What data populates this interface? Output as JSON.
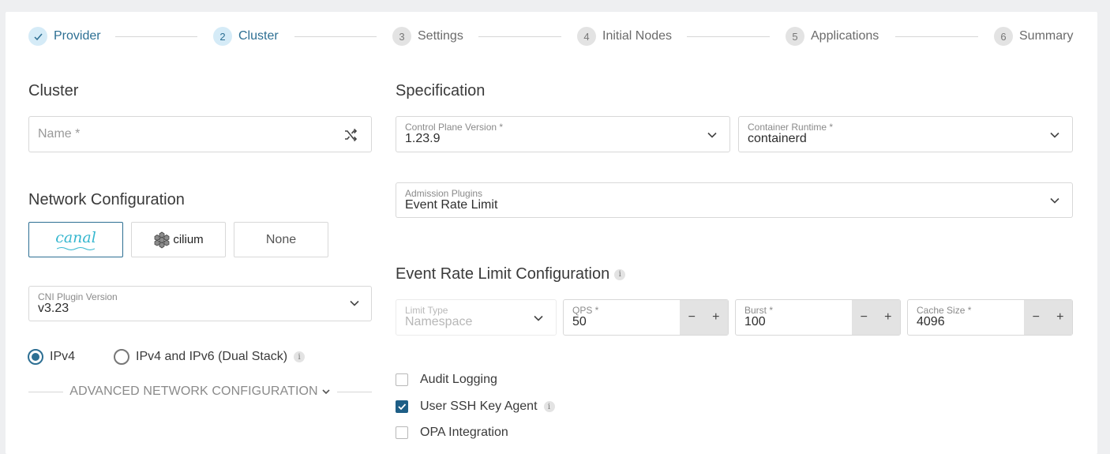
{
  "stepper": {
    "steps": [
      {
        "num": "",
        "label": "Provider",
        "state": "done"
      },
      {
        "num": "2",
        "label": "Cluster",
        "state": "active"
      },
      {
        "num": "3",
        "label": "Settings",
        "state": "pending"
      },
      {
        "num": "4",
        "label": "Initial Nodes",
        "state": "pending"
      },
      {
        "num": "5",
        "label": "Applications",
        "state": "pending"
      },
      {
        "num": "6",
        "label": "Summary",
        "state": "pending"
      }
    ]
  },
  "cluster": {
    "title": "Cluster",
    "name_placeholder": "Name *"
  },
  "network": {
    "title": "Network Configuration",
    "cni_options": [
      "canal",
      "cilium",
      "None"
    ],
    "selected_cni": "canal",
    "cni_version_label": "CNI Plugin Version",
    "cni_version_value": "v3.23",
    "ip_options": [
      "IPv4",
      "IPv4 and IPv6 (Dual Stack)"
    ],
    "selected_ip": "IPv4",
    "advanced_label": "ADVANCED NETWORK CONFIGURATION"
  },
  "spec": {
    "title": "Specification",
    "control_plane_label": "Control Plane Version *",
    "control_plane_value": "1.23.9",
    "runtime_label": "Container Runtime *",
    "runtime_value": "containerd",
    "admission_label": "Admission Plugins",
    "admission_value": "Event Rate Limit"
  },
  "event_rate": {
    "title": "Event Rate Limit Configuration",
    "limit_type_label": "Limit Type",
    "limit_type_value": "Namespace",
    "qps_label": "QPS *",
    "qps_value": "50",
    "burst_label": "Burst *",
    "burst_value": "100",
    "cache_label": "Cache Size *",
    "cache_value": "4096",
    "minus": "−",
    "plus": "+"
  },
  "options": {
    "audit_logging": {
      "label": "Audit Logging",
      "checked": false
    },
    "ssh_agent": {
      "label": "User SSH Key Agent",
      "checked": true
    },
    "opa": {
      "label": "OPA Integration",
      "checked": false
    }
  },
  "colors": {
    "accent": "#2d6f93",
    "checkbox": "#1e5e86",
    "canal": "#36b7cf"
  }
}
